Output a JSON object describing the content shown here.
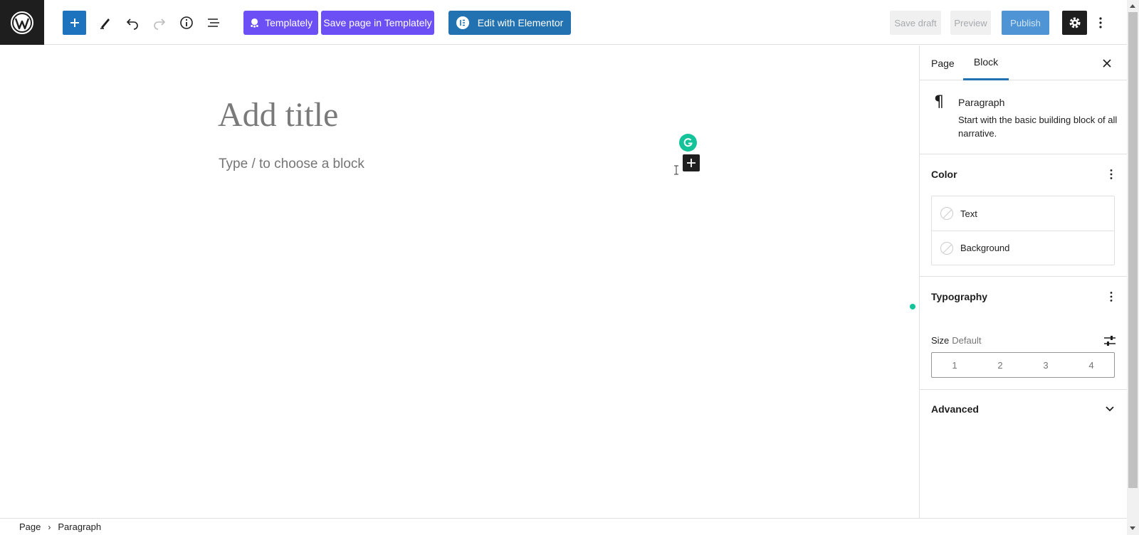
{
  "toolbar": {
    "templately_label": "Templately",
    "save_templately_label": "Save page in Templately",
    "elementor_label": "Edit with Elementor",
    "save_draft_label": "Save draft",
    "preview_label": "Preview",
    "publish_label": "Publish"
  },
  "editor": {
    "title_placeholder": "Add title",
    "block_placeholder": "Type / to choose a block"
  },
  "sidebar": {
    "tabs": [
      {
        "label": "Page"
      },
      {
        "label": "Block"
      }
    ],
    "active_tab": "Block",
    "block_card": {
      "title": "Paragraph",
      "description": "Start with the basic building block of all narrative."
    },
    "color": {
      "heading": "Color",
      "items": [
        {
          "label": "Text"
        },
        {
          "label": "Background"
        }
      ]
    },
    "typography": {
      "heading": "Typography",
      "size_label": "Size",
      "size_value": "Default",
      "size_options": [
        "1",
        "2",
        "3",
        "4"
      ]
    },
    "advanced": {
      "heading": "Advanced"
    }
  },
  "breadcrumb": {
    "items": [
      "Page",
      "Paragraph"
    ]
  },
  "colors": {
    "accent": "#2271b1",
    "templately": "#6c4ff5",
    "grammarly": "#15c39a",
    "dark": "#1e1e1e"
  }
}
